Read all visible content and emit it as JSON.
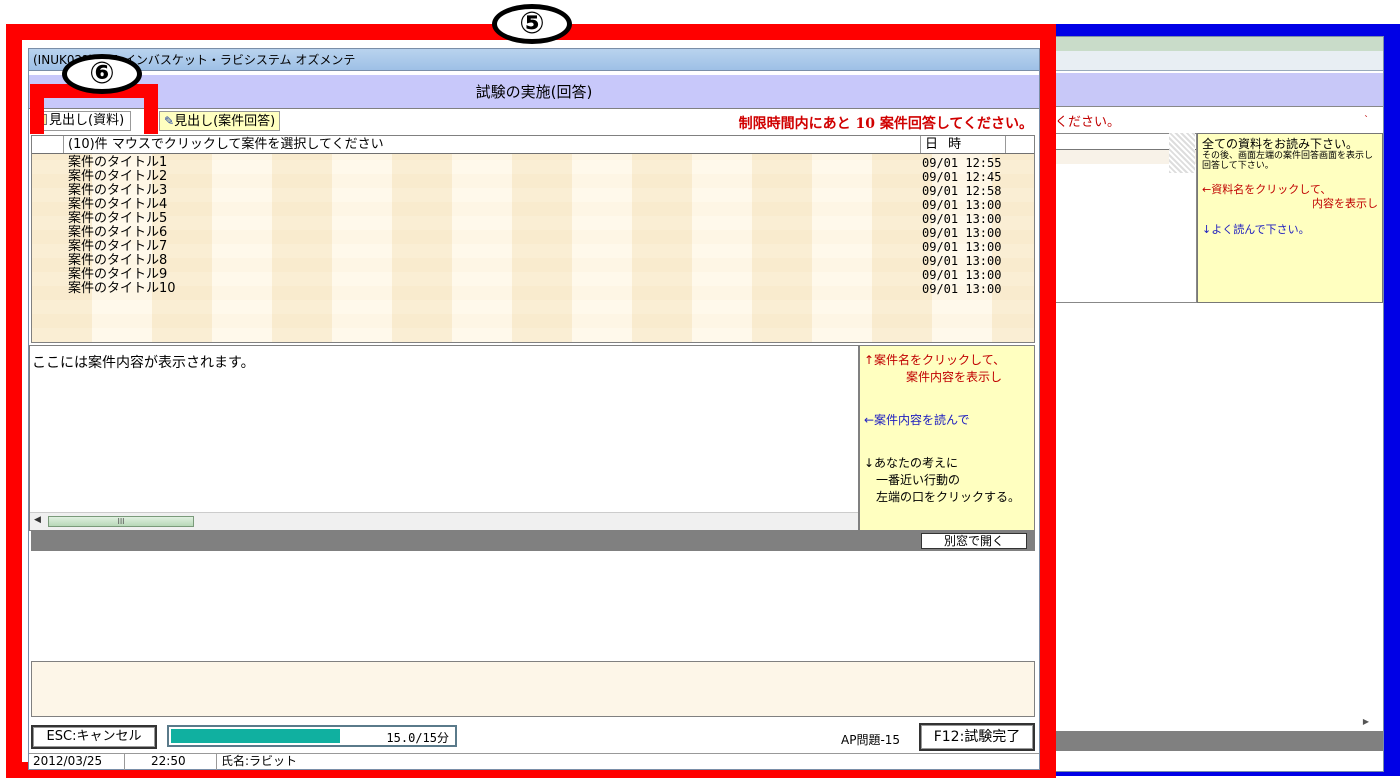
{
  "main_window": {
    "title": "(INUK02?) AP1  インバスケット・ラビシステム  オズメンテ",
    "header": "試験の実施(回答)",
    "tabs": [
      {
        "label": "見出し(資料)"
      },
      {
        "label": "見出し(案件回答)"
      }
    ],
    "remaining_message": "制限時間内にあと 10 案件回答してください。"
  },
  "case_list": {
    "count_label": "(10)件  マウスでクリックして案件を選択してください",
    "date_header": "日 時",
    "rows": [
      {
        "title": "案件のタイトル1",
        "datetime": "09/01 12:55"
      },
      {
        "title": "案件のタイトル2",
        "datetime": "09/01 12:45"
      },
      {
        "title": "案件のタイトル3",
        "datetime": "09/01 12:58"
      },
      {
        "title": "案件のタイトル4",
        "datetime": "09/01 13:00"
      },
      {
        "title": "案件のタイトル5",
        "datetime": "09/01 13:00"
      },
      {
        "title": "案件のタイトル6",
        "datetime": "09/01 13:00"
      },
      {
        "title": "案件のタイトル7",
        "datetime": "09/01 13:00"
      },
      {
        "title": "案件のタイトル8",
        "datetime": "09/01 13:00"
      },
      {
        "title": "案件のタイトル9",
        "datetime": "09/01 13:00"
      },
      {
        "title": "案件のタイトル10",
        "datetime": "09/01 13:00"
      }
    ]
  },
  "content": {
    "placeholder": "ここには案件内容が表示されます。",
    "scroll_thumb": "III"
  },
  "content_hint": {
    "line1": "↑案件名をクリックして、",
    "line2": "案件内容を表示し",
    "line3": "←案件内容を読んで",
    "line4": "↓あなたの考えに",
    "line5": "一番近い行動の",
    "line6": "左端の口をクリックする。"
  },
  "buttons": {
    "open_window": "別窓で開く",
    "esc": "ESC:キャンセル",
    "f12": "F12:試験完了"
  },
  "progress": {
    "text": "15.0/15分",
    "fraction": 0.6
  },
  "ap_label": "AP問題-15",
  "statusbar": {
    "date": "2012/03/25",
    "time": "22:50",
    "name": "氏名:ラビット"
  },
  "background_window": {
    "message": "ください。",
    "hint_line1": "全ての資料をお読み下さい。",
    "hint_line2": "その後、画面左端の案件回答画面を表示し回答して下さい。",
    "hint_line3": "←資料名をクリックして、",
    "hint_line4": "内容を表示し",
    "hint_line5": "↓よく読んで下さい。"
  },
  "callouts": {
    "five": "⑤",
    "six": "⑥"
  },
  "colors": {
    "highlight_red": "#ff0000",
    "background_blue": "#0000e6",
    "progress_fill": "#10b0a0",
    "warning_text": "#d00000"
  }
}
